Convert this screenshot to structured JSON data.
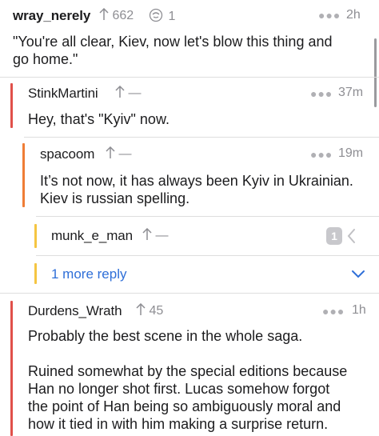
{
  "comments": [
    {
      "username": "wray_nerely",
      "score": "662",
      "awards": "1",
      "time": "2h",
      "body_lines": [
        "\"You're all clear, Kiev, now let's blow this thing and",
        "go home.\""
      ]
    },
    {
      "username": "StinkMartini",
      "score": "—",
      "time": "37m",
      "body_lines": [
        "Hey, that's \"Kyiv\" now."
      ]
    },
    {
      "username": "spacoom",
      "score": "—",
      "time": "19m",
      "body_lines": [
        "It’s not now, it has always been Kyiv in Ukrainian.",
        "Kiev is russian spelling."
      ]
    },
    {
      "username": "munk_e_man",
      "score": "—",
      "collapsed_count": "1"
    },
    {
      "username": "Durdens_Wrath",
      "score": "45",
      "time": "1h",
      "body_lines": [
        "Probably the best scene in the whole saga.",
        "",
        "Ruined somewhat by the special editions because",
        "Han no longer shot first.  Lucas somehow forgot",
        "the point of Han being so ambiguously moral and",
        "how it tied in with him making a surprise return."
      ]
    }
  ],
  "more_replies": {
    "label": "1 more reply"
  },
  "icons": {
    "more": "more-options-icon",
    "upvote": "upvote-arrow-icon",
    "award": "award-icon",
    "expand": "chevron-down-icon"
  },
  "colors": {
    "depth1": "#e0504a",
    "depth2": "#ef7d36",
    "depth3": "#f5c542",
    "link": "#2f6fd8",
    "text": "#1c1c1e",
    "meta": "#8e8e93"
  }
}
